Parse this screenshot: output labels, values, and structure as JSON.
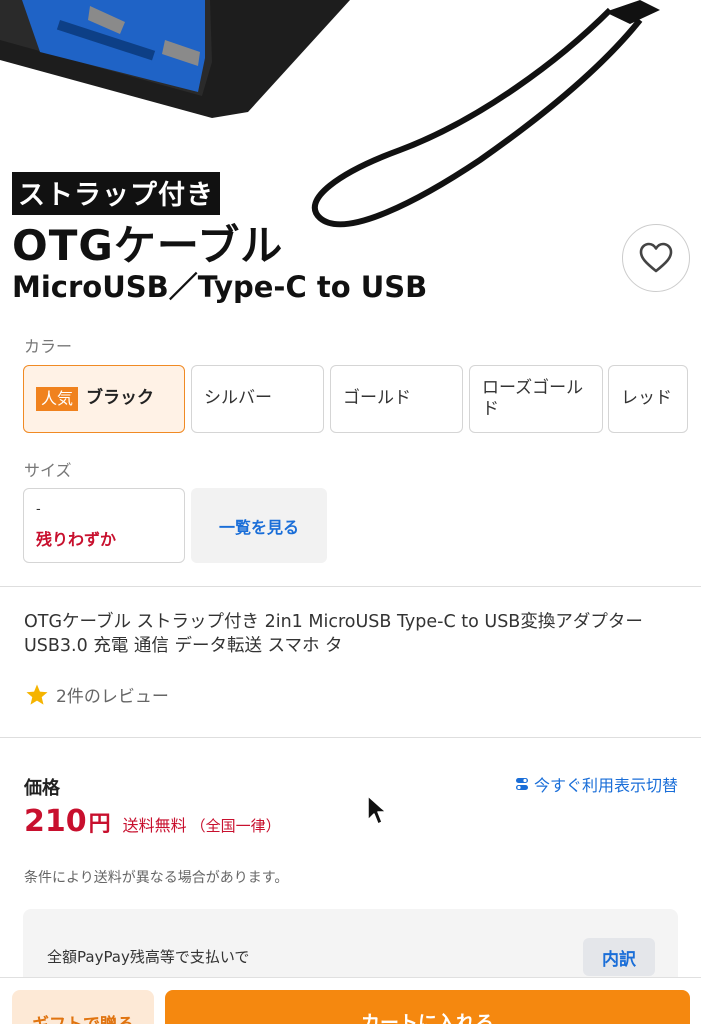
{
  "hero": {
    "tag": "ストラップ付き",
    "title": "OTGケーブル",
    "subtitle": "MicroUSB／Type-C to USB"
  },
  "favorite_icon": "heart-outline-icon",
  "color_section": {
    "label": "カラー",
    "options": [
      {
        "badge": "人気",
        "label": "ブラック",
        "selected": true
      },
      {
        "label": "シルバー"
      },
      {
        "label": "ゴールド"
      },
      {
        "label": "ローズゴールド"
      },
      {
        "label": "レッド"
      }
    ]
  },
  "size_section": {
    "label": "サイズ",
    "option": {
      "value": "-",
      "stock": "残りわずか"
    },
    "view_all": "一覧を見る"
  },
  "product": {
    "name": "OTGケーブル ストラップ付き 2in1 MicroUSB Type-C to USB変換アダプター USB3.0 充電 通信 データ転送 スマホ タ",
    "review_text": "2件のレビュー"
  },
  "price": {
    "label": "価格",
    "toggle": "今すぐ利用表示切替",
    "amount": "210",
    "unit": "円",
    "shipping": "送料無料",
    "region": "（全国一律）",
    "note": "条件により送料が異なる場合があります。"
  },
  "payment": {
    "text": "全額PayPay残高等で支払いで",
    "breakdown": "内訳"
  },
  "actions": {
    "gift": "ギフトで贈る",
    "cart": "カートに入れる"
  },
  "colors": {
    "accent_orange": "#f5880f",
    "price_red": "#c8102e",
    "link_blue": "#1a6ed8"
  }
}
